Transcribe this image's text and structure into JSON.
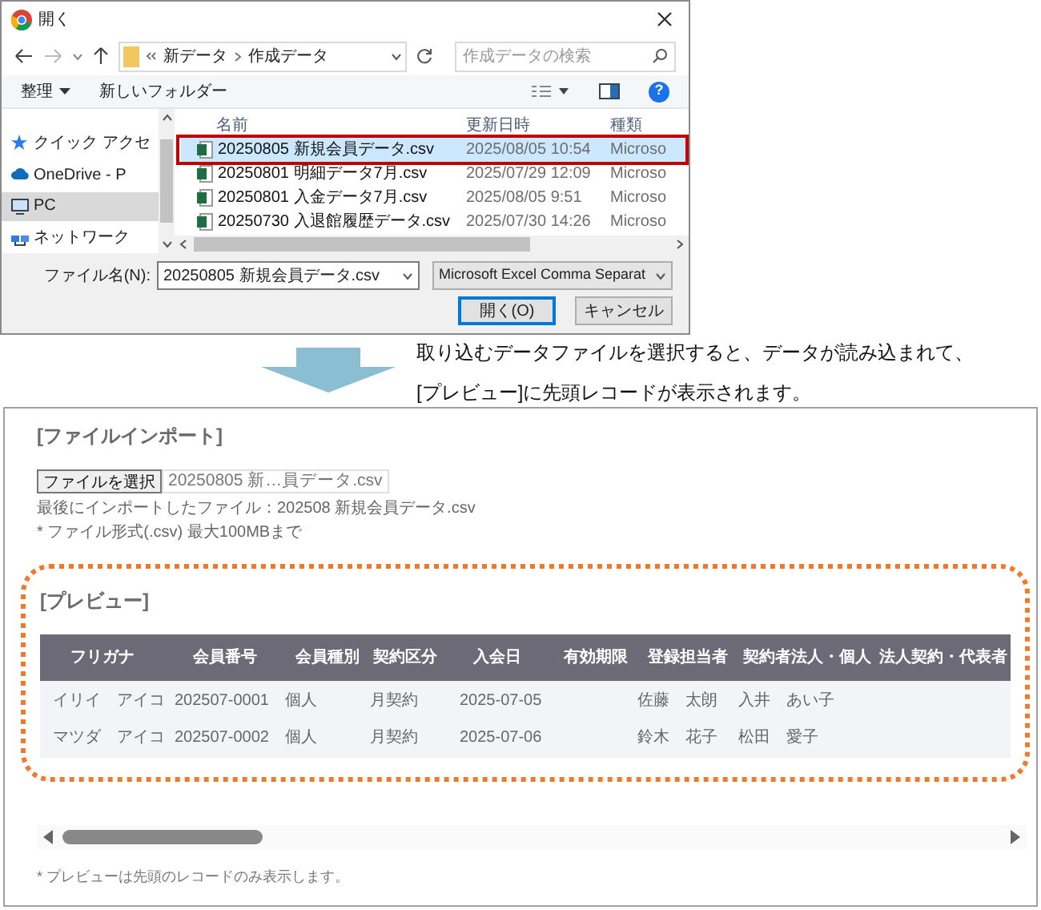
{
  "dialog": {
    "title": "開く",
    "path": [
      "新データ",
      "作成データ"
    ],
    "search_placeholder": "作成データの検索",
    "toolbar": [
      {
        "label": "整理",
        "kind": "menu"
      },
      {
        "label": "新しいフォルダー",
        "kind": "button"
      }
    ],
    "help": "?",
    "sidebar": [
      {
        "label": "クイック アクセ",
        "kind": "star",
        "selected": false
      },
      {
        "label": "OneDrive - P",
        "kind": "cloud",
        "selected": false
      },
      {
        "label": "PC",
        "kind": "pc",
        "selected": true
      },
      {
        "label": "ネットワーク",
        "kind": "network",
        "selected": false
      }
    ],
    "columns": [
      "名前",
      "更新日時",
      "種類"
    ],
    "files": [
      {
        "name": "20250805 新規会員データ.csv",
        "modified": "2025/08/05 10:54",
        "type": "Microso",
        "selected": true,
        "highlighted": true
      },
      {
        "name": "20250801 明細データ7月.csv",
        "modified": "2025/07/29 12:09",
        "type": "Microso",
        "selected": false,
        "highlighted": false
      },
      {
        "name": "20250801 入金データ7月.csv",
        "modified": "2025/08/05 9:51",
        "type": "Microso",
        "selected": false,
        "highlighted": false
      },
      {
        "name": "20250730 入退館履歴データ.csv",
        "modified": "2025/07/30 14:26",
        "type": "Microso",
        "selected": false,
        "highlighted": false
      }
    ],
    "filename_label": "ファイル名(N):",
    "filename": "20250805 新規会員データ.csv",
    "filter": "Microsoft Excel Comma Separat",
    "buttons": [
      {
        "label": "開く(O)",
        "kind": "primary"
      },
      {
        "label": "キャンセル",
        "kind": "secondary"
      }
    ]
  },
  "caption": [
    "取り込むデータファイルを選択すると、データが読み込まれて、",
    "[プレビュー]に先頭レコードが表示されます。"
  ],
  "import": {
    "heading": "[ファイルインポート]",
    "choose_button": "ファイルを選択",
    "chosen_file": "20250805 新…員データ.csv",
    "last_file": "最後にインポートしたファイル：202508 新規会員データ.csv",
    "note": "* ファイル形式(.csv) 最大100MBまで"
  },
  "preview": {
    "heading": "[プレビュー]",
    "highlighted": true,
    "columns": [
      "フリガナ",
      "会員番号",
      "会員種別",
      "契約区分",
      "入会日",
      "有効期限",
      "登録担当者",
      "契約者法人・個人",
      "法人契約・代表者"
    ],
    "rows": [
      [
        "イリイ　アイコ",
        "202507-0001",
        "個人",
        "月契約",
        "2025-07-05",
        null,
        "佐藤　太朗",
        "入井　あい子",
        null
      ],
      [
        "マツダ　アイコ",
        "202507-0002",
        "個人",
        "月契約",
        "2025-07-06",
        null,
        "鈴木　花子",
        "松田　愛子",
        null
      ]
    ],
    "note": "* プレビューは先頭のレコードのみ表示します。"
  }
}
